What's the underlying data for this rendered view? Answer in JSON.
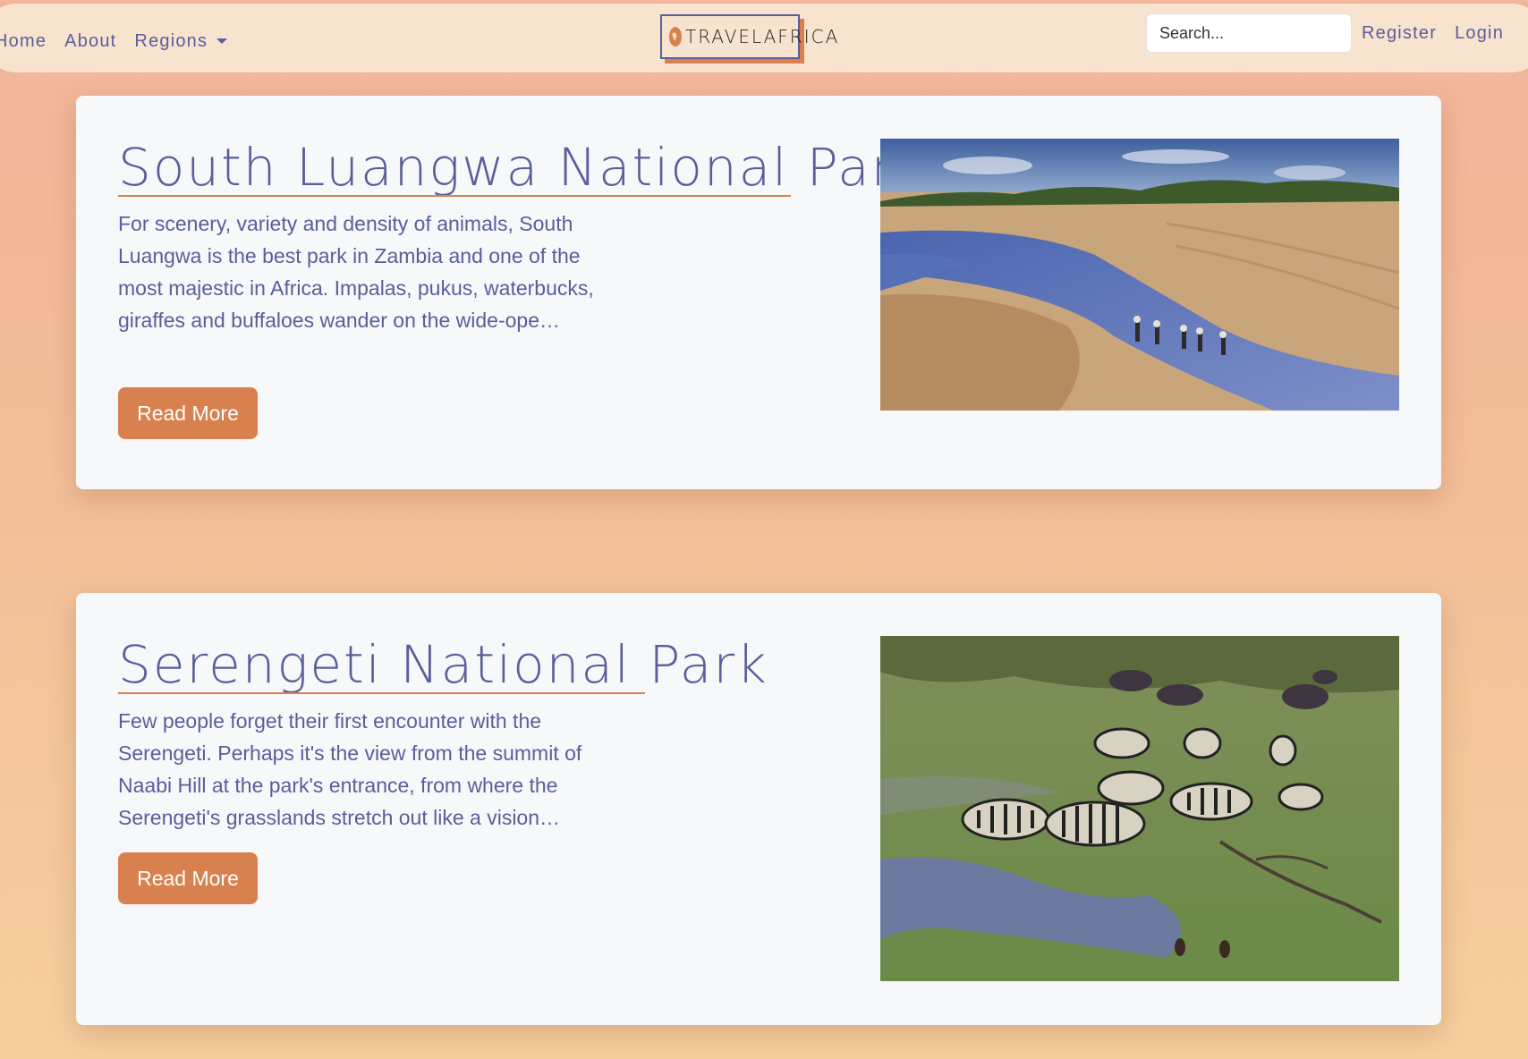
{
  "nav": {
    "home": "Home",
    "about": "About",
    "regions": "Regions",
    "brand": "TRAVELAFRICA",
    "search_placeholder": "Search...",
    "register": "Register",
    "login": "Login"
  },
  "cards": [
    {
      "title": "South Luangwa National Park",
      "text": "For scenery, variety and density of animals, South Luangwa is the best park in Zambia and one of the most majestic in Africa. Impalas, pukus, waterbucks, giraffes and buffaloes wander on the wide-ope…",
      "button": "Read More"
    },
    {
      "title": "Serengeti National Park",
      "text": "Few people forget their first encounter with the Serengeti. Perhaps it's the view from the summit of Naabi Hill at the park's entrance, from where the Serengeti's grasslands stretch out like a vision…",
      "button": "Read More"
    }
  ],
  "colors": {
    "accent": "#d9804f",
    "text": "#5a5e9a",
    "card_bg": "#f7f8fa",
    "navbar_bg": "#f8e3cf"
  }
}
